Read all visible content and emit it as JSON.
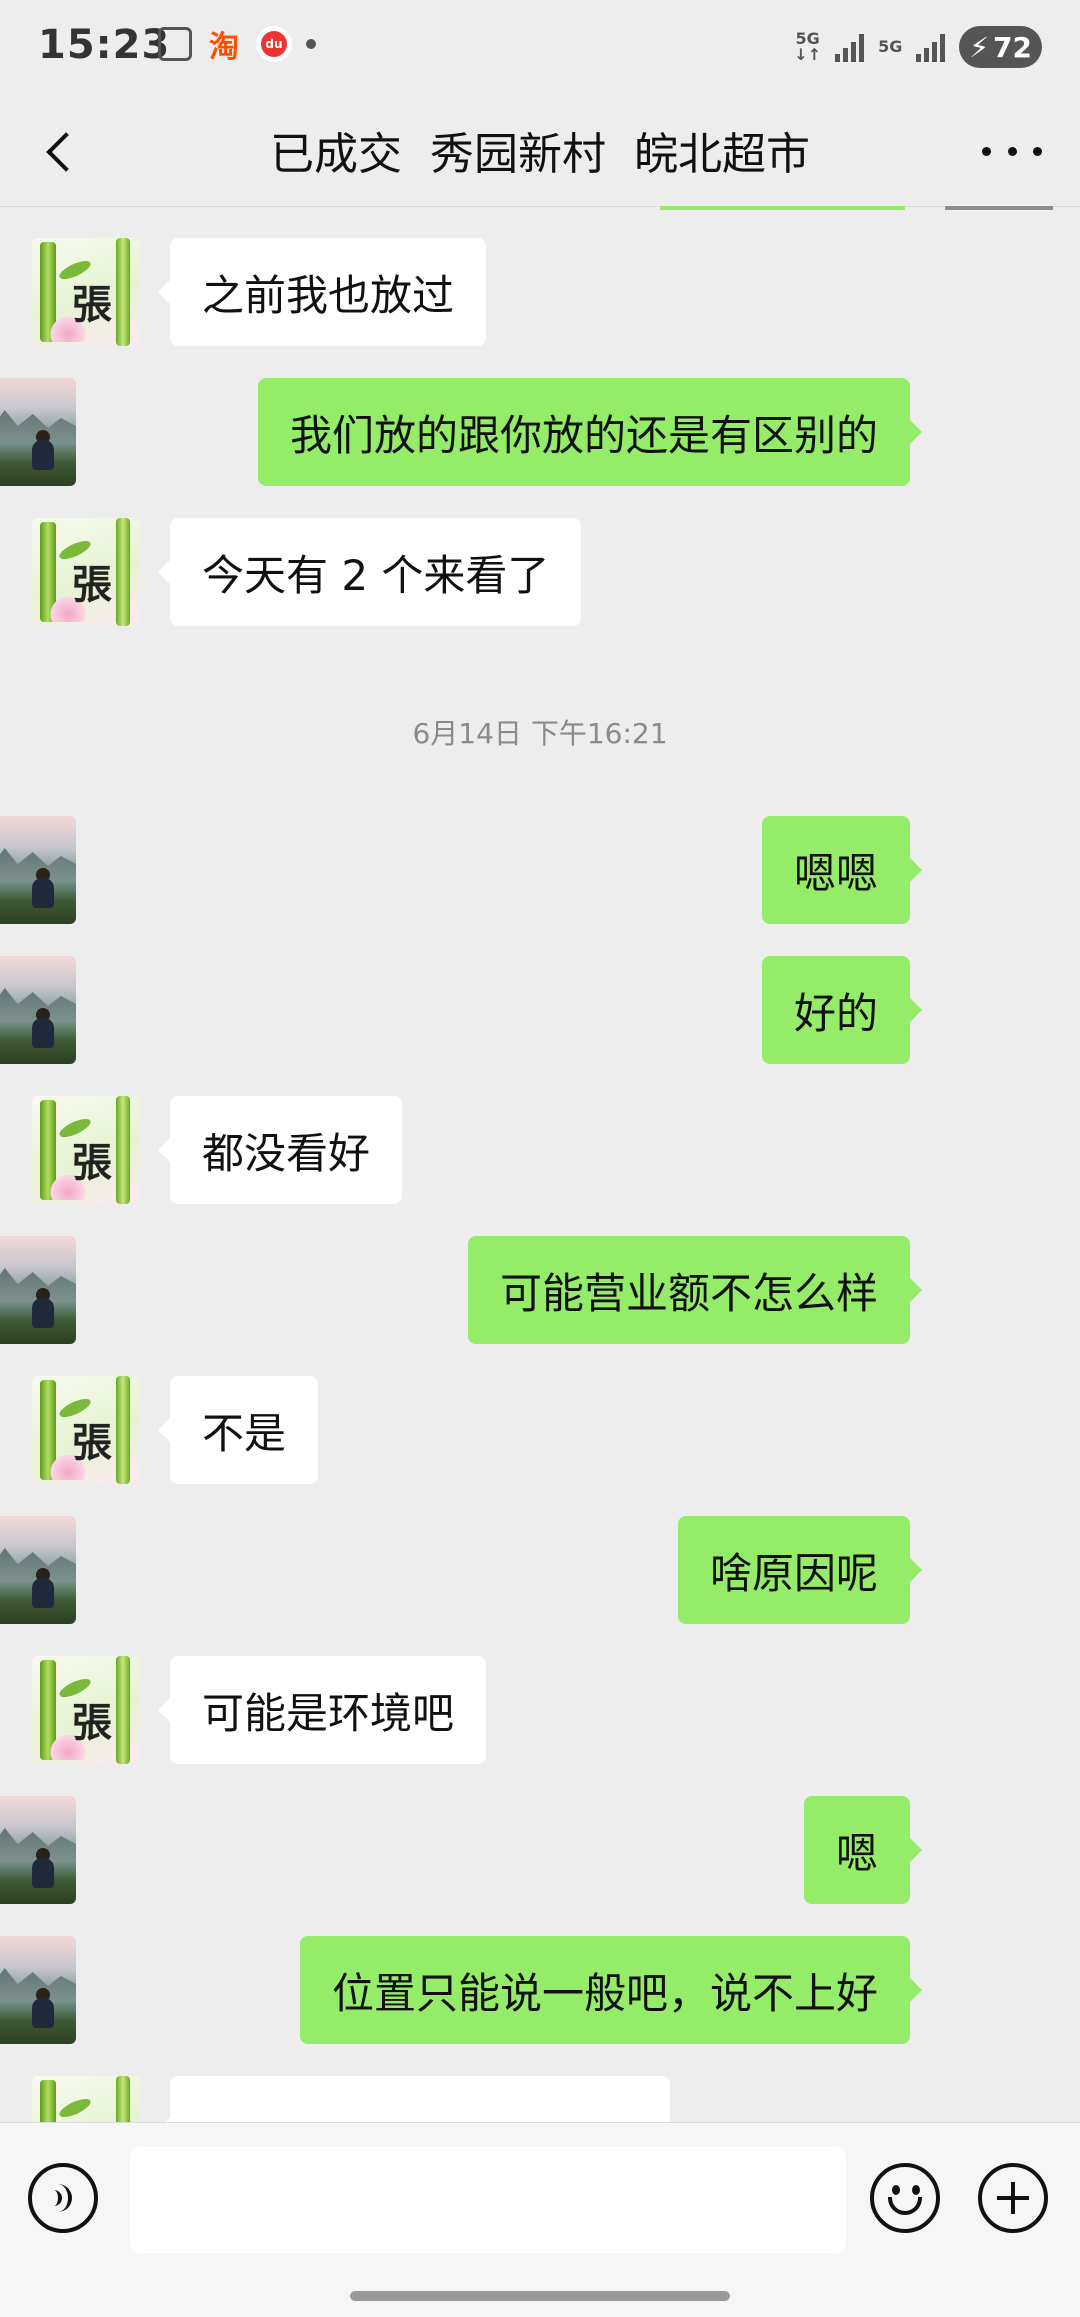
{
  "status_bar": {
    "time": "15:23",
    "app_icons": [
      "scan-icon",
      "taobao-icon",
      "baidu-map-icon"
    ],
    "network_1": "5G",
    "network_2": "5G",
    "battery": "72"
  },
  "header": {
    "title": "已成交  秀园新村  皖北超市",
    "back_icon": "back-arrow-icon",
    "more_icon": "more-dots-icon"
  },
  "messages": [
    {
      "side": "left",
      "avatar": "avatar-zhang",
      "text": "之前我也放过"
    },
    {
      "side": "right",
      "avatar": "avatar-self",
      "text": "我们放的跟你放的还是有区别的"
    },
    {
      "side": "left",
      "avatar": "avatar-zhang",
      "text": "今天有 2 个来看了"
    },
    {
      "type": "timestamp",
      "text": "6月14日 下午16:21"
    },
    {
      "side": "right",
      "avatar": "avatar-self",
      "text": "嗯嗯"
    },
    {
      "side": "right",
      "avatar": "avatar-self",
      "text": "好的"
    },
    {
      "side": "left",
      "avatar": "avatar-zhang",
      "text": "都没看好"
    },
    {
      "side": "right",
      "avatar": "avatar-self",
      "text": "可能营业额不怎么样"
    },
    {
      "side": "left",
      "avatar": "avatar-zhang",
      "text": "不是"
    },
    {
      "side": "right",
      "avatar": "avatar-self",
      "text": "啥原因呢"
    },
    {
      "side": "left",
      "avatar": "avatar-zhang",
      "text": "可能是环境吧"
    },
    {
      "side": "right",
      "avatar": "avatar-self",
      "text": "嗯"
    },
    {
      "side": "right",
      "avatar": "avatar-self",
      "text": "位置只能说一般吧，说不上好"
    }
  ],
  "input_bar": {
    "voice_icon": "voice-icon",
    "emoji_icon": "emoji-icon",
    "plus_icon": "plus-icon",
    "input_value": ""
  },
  "colors": {
    "background": "#ededed",
    "self_bubble": "#95ec69",
    "other_bubble": "#ffffff"
  }
}
